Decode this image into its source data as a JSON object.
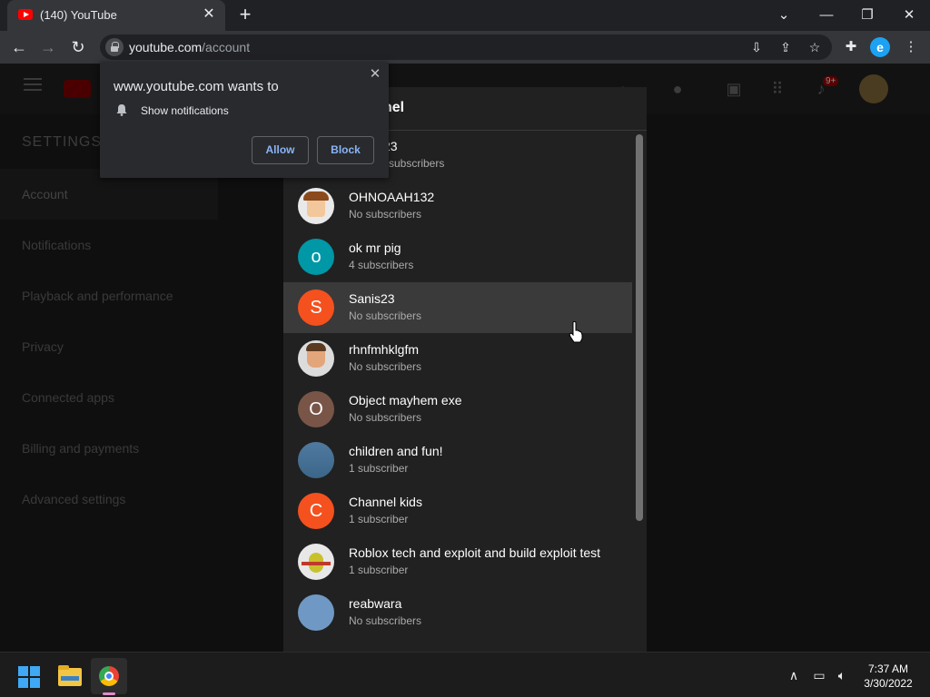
{
  "browser": {
    "tab_title": "(140) YouTube",
    "url_domain": "youtube.com",
    "url_path": "/account",
    "profile_letter": "e",
    "new_tab": "+",
    "tab_close": "✕"
  },
  "popup": {
    "title": "www.youtube.com wants to",
    "permission": "Show notifications",
    "allow_label": "Allow",
    "block_label": "Block",
    "close": "✕"
  },
  "yt": {
    "notification_badge": "9+",
    "settings_title": "SETTINGS",
    "settings_items": [
      {
        "label": "Account"
      },
      {
        "label": "Notifications"
      },
      {
        "label": "Playback and performance"
      },
      {
        "label": "Privacy"
      },
      {
        "label": "Connected apps"
      },
      {
        "label": "Billing and payments"
      },
      {
        "label": "Advanced settings"
      }
    ]
  },
  "dialog": {
    "title_fragment": "nel",
    "channels": [
      {
        "name": "23",
        "subs": "subscribers",
        "avatar_letter": "",
        "avatar_color": "#cfcfcf"
      },
      {
        "name": "OHNOAAH132",
        "subs": "No subscribers",
        "avatar_letter": "",
        "avatar_color": "#e9e9e9"
      },
      {
        "name": "ok mr pig",
        "subs": "4 subscribers",
        "avatar_letter": "o",
        "avatar_color": "#0097a7"
      },
      {
        "name": "Sanis23",
        "subs": "No subscribers",
        "avatar_letter": "S",
        "avatar_color": "#f4511e"
      },
      {
        "name": "rhnfmhklgfm",
        "subs": "No subscribers",
        "avatar_letter": "",
        "avatar_color": "#dcdcdc"
      },
      {
        "name": "Object mayhem exe",
        "subs": "No subscribers",
        "avatar_letter": "O",
        "avatar_color": "#795548"
      },
      {
        "name": "children and fun!",
        "subs": "1 subscriber",
        "avatar_letter": "",
        "avatar_color": "#4f79a0"
      },
      {
        "name": "Channel kids",
        "subs": "1 subscriber",
        "avatar_letter": "C",
        "avatar_color": "#f4511e"
      },
      {
        "name": "Roblox tech and exploit and build exploit test",
        "subs": "1 subscriber",
        "avatar_letter": "",
        "avatar_color": "#e8e8e8"
      },
      {
        "name": "reabwara",
        "subs": "No subscribers",
        "avatar_letter": "",
        "avatar_color": "#6f99c4"
      }
    ]
  },
  "taskbar": {
    "time": "7:37 AM",
    "date": "3/30/2022"
  }
}
